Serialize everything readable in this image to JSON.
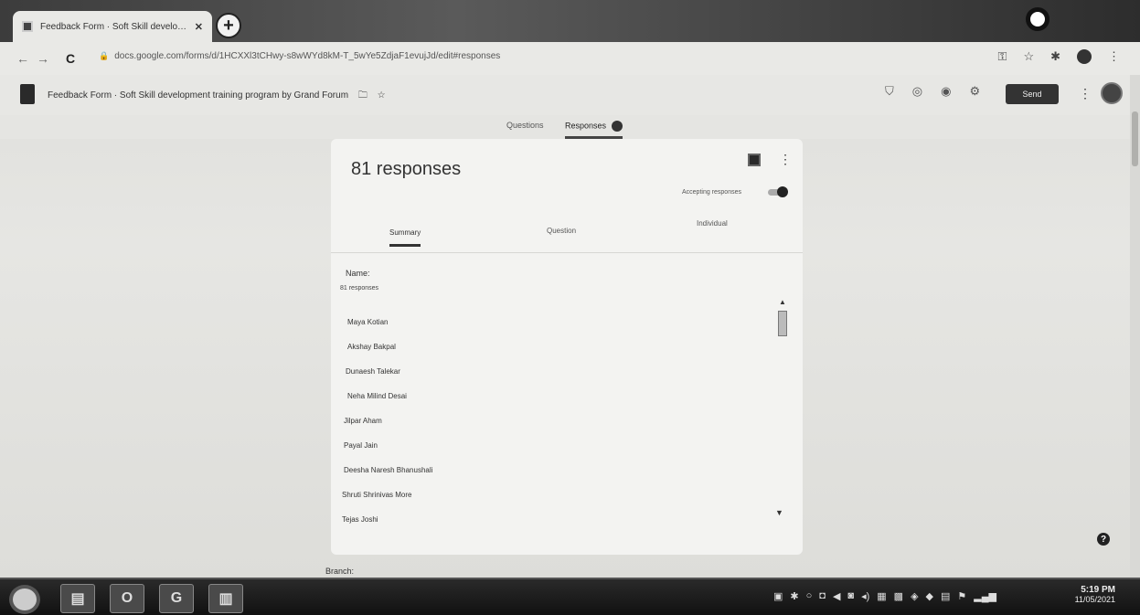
{
  "browser": {
    "tab_title": "Feedback Form · Soft Skill develo…",
    "tab_close": "✕",
    "new_tab": "+",
    "url": "docs.google.com/forms/d/1HCXXl3tCHwy-s8wWYd8kM-T_5wYe5ZdjaF1evujJd/edit#responses",
    "lock": "🔒"
  },
  "forms": {
    "title": "Feedback Form · Soft Skill development training program by Grand Forum",
    "send_label": "Send",
    "more": "⋮"
  },
  "tabs": {
    "questions": "Questions",
    "responses": "Responses"
  },
  "summary": {
    "title": "81 responses",
    "accepting": "Accepting responses",
    "subtabs": {
      "summary": "Summary",
      "question": "Question",
      "individual": "Individual"
    },
    "question_name": "Name:",
    "question_count": "81 responses",
    "names": [
      "Maya Kotian",
      "Akshay Bakpal",
      "Dunaesh Talekar",
      "Neha Milind Desai",
      "Jilpar Aham",
      "Payal Jain",
      "Deesha Naresh Bhanushali",
      "Shruti Shrinivas More",
      "Tejas Joshi"
    ],
    "next_question": "Branch:"
  },
  "taskbar": {
    "time": "5:19 PM",
    "date": "11/05/2021"
  },
  "icons": {
    "forms_doc": "doc-icon",
    "sheets": "sheets-icon",
    "help": "help-icon"
  }
}
